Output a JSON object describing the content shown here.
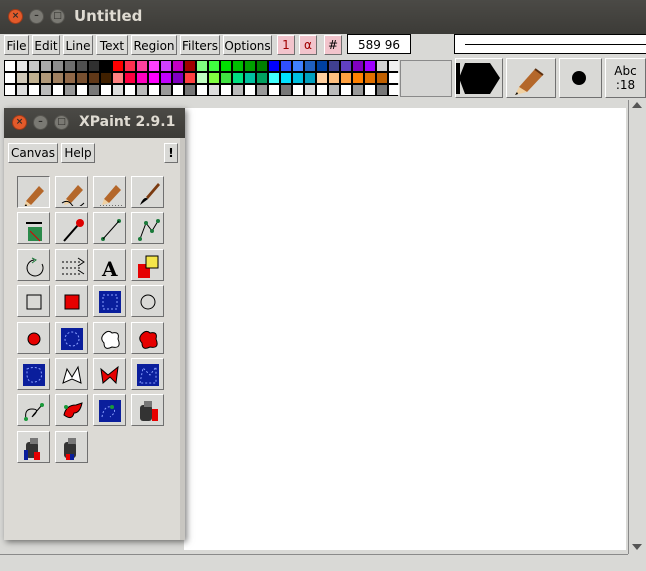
{
  "window": {
    "title": "Untitled"
  },
  "menu": {
    "file": "File",
    "edit": "Edit",
    "line": "Line",
    "text": "Text",
    "region": "Region",
    "filters": "Filters",
    "options": "Options"
  },
  "quick": {
    "one": "1",
    "alpha": "α",
    "hash": "#"
  },
  "coords": "589 96",
  "text_tool": {
    "label": "Abc",
    "size": ":18"
  },
  "toolwin": {
    "title": "XPaint 2.9.1",
    "canvas": "Canvas",
    "help": "Help",
    "bang": "!"
  },
  "tools": [
    "pencil",
    "dynamic-pencil",
    "dotted-pencil",
    "brush",
    "spray",
    "erase-dropper",
    "line",
    "polyline",
    "arc",
    "arrow",
    "text",
    "fill",
    "box",
    "filled-box",
    "selection-box",
    "oval",
    "filled-oval",
    "selection-oval",
    "freehand-shape",
    "filled-freehand-shape",
    "selection-freehand",
    "polygon",
    "filled-polygon",
    "selection-polygon",
    "spline",
    "filled-spline",
    "selection-spline",
    "smooth-fill",
    "gradient-fill",
    "fractal-fill"
  ],
  "colors": {
    "accent": "#e35a2a",
    "titlebar": "#3c3b37",
    "pink_button": "#f2c4cc",
    "selection_blue": "#0a1e9c",
    "fill_red": "#e60000"
  }
}
